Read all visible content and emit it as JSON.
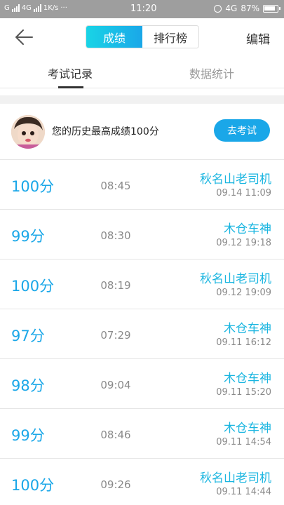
{
  "status_bar": {
    "carrier1": "G",
    "carrier2": "4G",
    "speed": "1K/s",
    "more": "···",
    "time": "11:20",
    "network": "4G",
    "battery": "87%"
  },
  "header": {
    "back_icon": "arrow-left-icon",
    "segments": [
      "成绩",
      "排行榜"
    ],
    "active_segment": 0,
    "edit_label": "编辑"
  },
  "subtabs": [
    "考试记录",
    "数据统计"
  ],
  "best": {
    "text": "您的历史最高成绩100分",
    "button": "去考试"
  },
  "records": [
    {
      "score": "100分",
      "duration": "08:45",
      "name": "秋名山老司机",
      "date": "09.14  11:09"
    },
    {
      "score": "99分",
      "duration": "08:30",
      "name": "木仓车神",
      "date": "09.12  19:18"
    },
    {
      "score": "100分",
      "duration": "08:19",
      "name": "秋名山老司机",
      "date": "09.12  19:09"
    },
    {
      "score": "97分",
      "duration": "07:29",
      "name": "木仓车神",
      "date": "09.11  16:12"
    },
    {
      "score": "98分",
      "duration": "09:04",
      "name": "木仓车神",
      "date": "09.11  15:20"
    },
    {
      "score": "99分",
      "duration": "08:46",
      "name": "木仓车神",
      "date": "09.11  14:54"
    },
    {
      "score": "100分",
      "duration": "09:26",
      "name": "秋名山老司机",
      "date": "09.11  14:44"
    }
  ],
  "colors": {
    "accent": "#1aa7e8",
    "accent_light": "#19d4e6",
    "status_bar": "#9e9e9e"
  }
}
